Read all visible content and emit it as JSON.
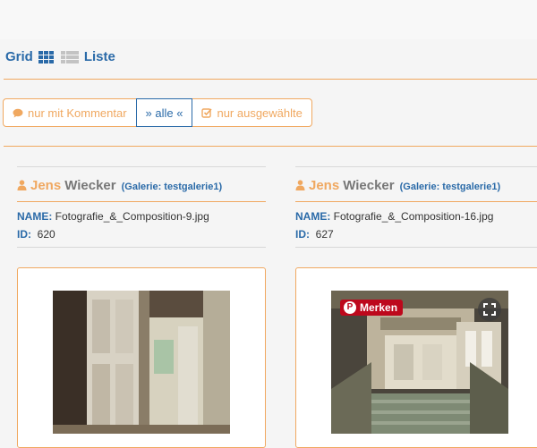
{
  "view_toggle": {
    "grid_label": "Grid",
    "list_label": "Liste",
    "grid_icon": "grid-icon",
    "list_icon": "list-icon"
  },
  "filters": [
    {
      "label": "nur mit Kommentar",
      "icon": "comment-icon",
      "active": false
    },
    {
      "label": "» alle «",
      "icon": "",
      "active": true
    },
    {
      "label": "nur ausgewählte",
      "icon": "check-square-icon",
      "active": false
    }
  ],
  "colors": {
    "accent": "#f0a860",
    "link": "#2a6aa8",
    "pinterest": "#bd081c"
  },
  "cards": [
    {
      "first_name": "Jens",
      "last_name": "Wiecker",
      "gallery": "(Galerie: testgalerie1)",
      "name_label": "NAME:",
      "name_value": "Fotografie_&_Composition-9.jpg",
      "id_label": "ID:",
      "id_value": "620",
      "pin_label": "",
      "has_overlay": false
    },
    {
      "first_name": "Jens",
      "last_name": "Wiecker",
      "gallery": "(Galerie: testgalerie1)",
      "name_label": "NAME:",
      "name_value": "Fotografie_&_Composition-16.jpg",
      "id_label": "ID:",
      "id_value": "627",
      "pin_label": "Merken",
      "has_overlay": true
    }
  ]
}
